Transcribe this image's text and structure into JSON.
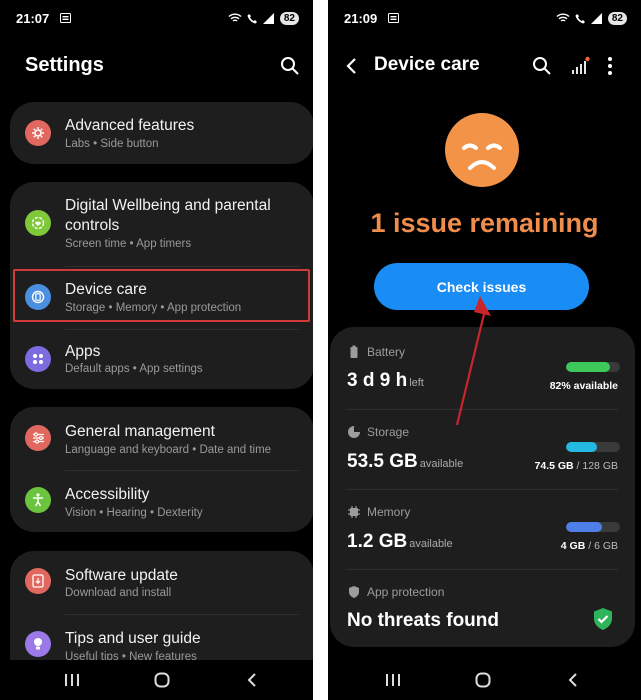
{
  "left": {
    "status": {
      "time": "21:07",
      "battery": "82"
    },
    "title": "Settings",
    "cards": [
      {
        "items": [
          {
            "key": "advanced",
            "title": "Advanced features",
            "sub": "Labs  •  Side button",
            "color": "#e0685f"
          }
        ]
      },
      {
        "items": [
          {
            "key": "wellbeing",
            "title": "Digital Wellbeing and parental controls",
            "sub": "Screen time  •  App timers",
            "color": "#7ec83a"
          },
          {
            "key": "devicecare",
            "title": "Device care",
            "sub": "Storage  •  Memory  •  App protection",
            "color": "#4a8fe0"
          },
          {
            "key": "apps",
            "title": "Apps",
            "sub": "Default apps  •  App settings",
            "color": "#7b6ce0"
          }
        ]
      },
      {
        "items": [
          {
            "key": "general",
            "title": "General management",
            "sub": "Language and keyboard  •  Date and time",
            "color": "#e0685f"
          },
          {
            "key": "accessibility",
            "title": "Accessibility",
            "sub": "Vision  •  Hearing  •  Dexterity",
            "color": "#6ac43d"
          }
        ]
      },
      {
        "items": [
          {
            "key": "update",
            "title": "Software update",
            "sub": "Download and install",
            "color": "#e0685f"
          },
          {
            "key": "tips",
            "title": "Tips and user guide",
            "sub": "Useful tips  •  New features",
            "color": "#9b7ae8"
          }
        ]
      }
    ]
  },
  "right": {
    "status": {
      "time": "21:09",
      "battery": "82"
    },
    "title": "Device care",
    "issue_text": "1 issue remaining",
    "check_label": "Check issues",
    "battery": {
      "label": "Battery",
      "value": "3 d 9 h",
      "unit": "left",
      "right": "82% available",
      "level": 0.82,
      "color": "#3dc85a"
    },
    "storage": {
      "label": "Storage",
      "value": "53.5 GB",
      "unit": "available",
      "used": "74.5 GB",
      "total": "/ 128 GB",
      "level": 0.58,
      "color": "#23b9e0"
    },
    "memory": {
      "label": "Memory",
      "value": "1.2 GB",
      "unit": "available",
      "used": "4 GB",
      "total": "/ 6 GB",
      "level": 0.67,
      "color": "#4e7fe8"
    },
    "protection": {
      "label": "App protection",
      "value": "No threats found"
    }
  },
  "colors": {
    "accent_blue": "#1a8cf5",
    "issue_orange": "#f08d4d",
    "highlight_red": "#d23a3a"
  }
}
